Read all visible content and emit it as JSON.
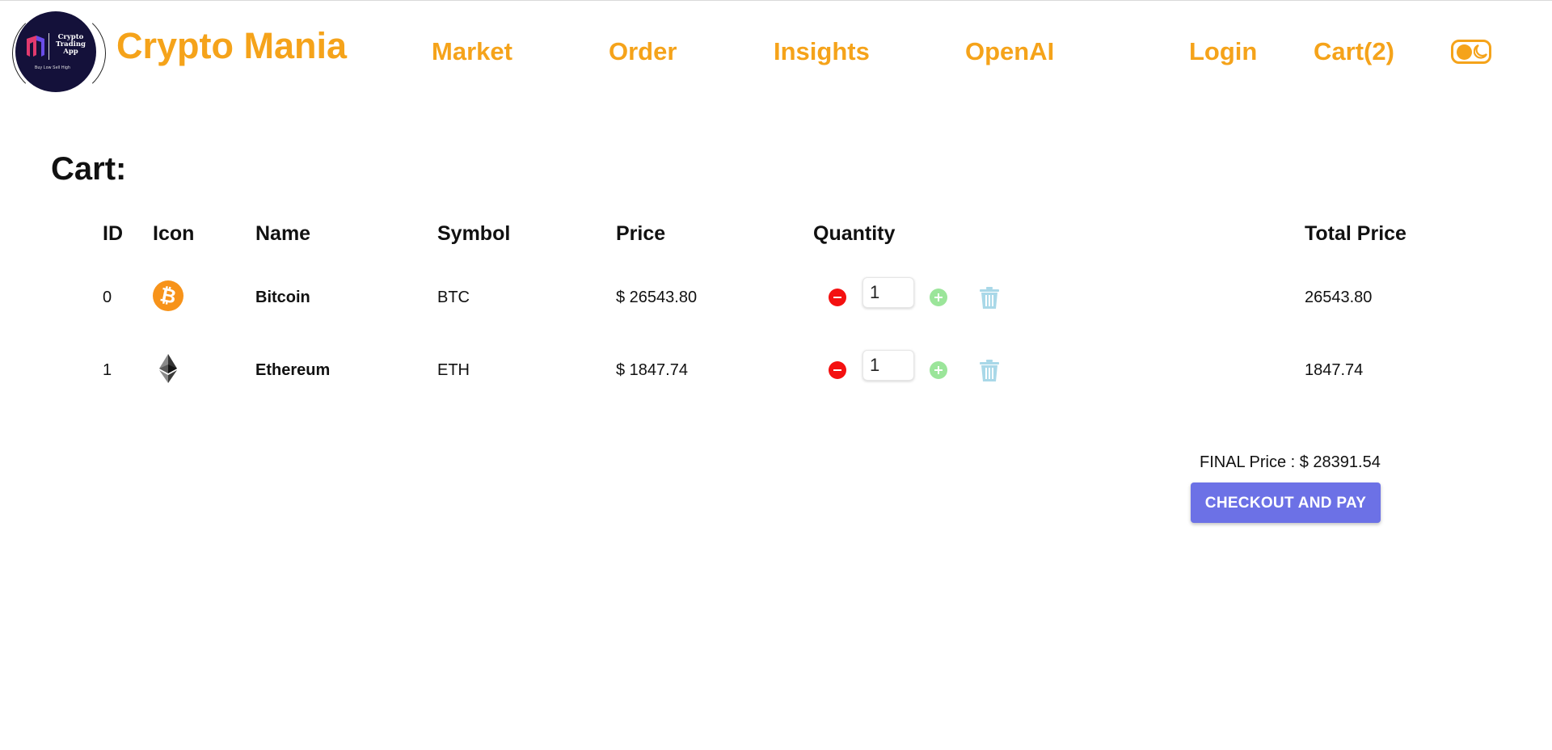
{
  "header": {
    "logo": {
      "line1": "Crypto",
      "line2": "Trading",
      "line3": "App",
      "tagline": "Buy Low Sell High"
    },
    "brand": "Crypto Mania",
    "nav": {
      "market": "Market",
      "order": "Order",
      "insights": "Insights",
      "openai": "OpenAI",
      "login": "Login",
      "cart": "Cart(2)"
    },
    "theme_toggle_icon": "moon-icon"
  },
  "cart": {
    "title": "Cart:",
    "columns": [
      "ID",
      "Icon",
      "Name",
      "Symbol",
      "Price",
      "Quantity",
      "Total Price"
    ],
    "items": [
      {
        "id": "0",
        "icon": "bitcoin-icon",
        "name": "Bitcoin",
        "symbol": "BTC",
        "price": "$ 26543.80",
        "quantity": "1",
        "total": "26543.80"
      },
      {
        "id": "1",
        "icon": "ethereum-icon",
        "name": "Ethereum",
        "symbol": "ETH",
        "price": "$ 1847.74",
        "quantity": "1",
        "total": "1847.74"
      }
    ],
    "final_price": "FINAL Price : $ 28391.54",
    "checkout_label": "CHECKOUT AND PAY"
  },
  "colors": {
    "accent": "#f5a31a",
    "checkout": "#6c71e6",
    "minus": "#f41010",
    "plus": "#9be59a",
    "trash": "#a9d8e8"
  }
}
